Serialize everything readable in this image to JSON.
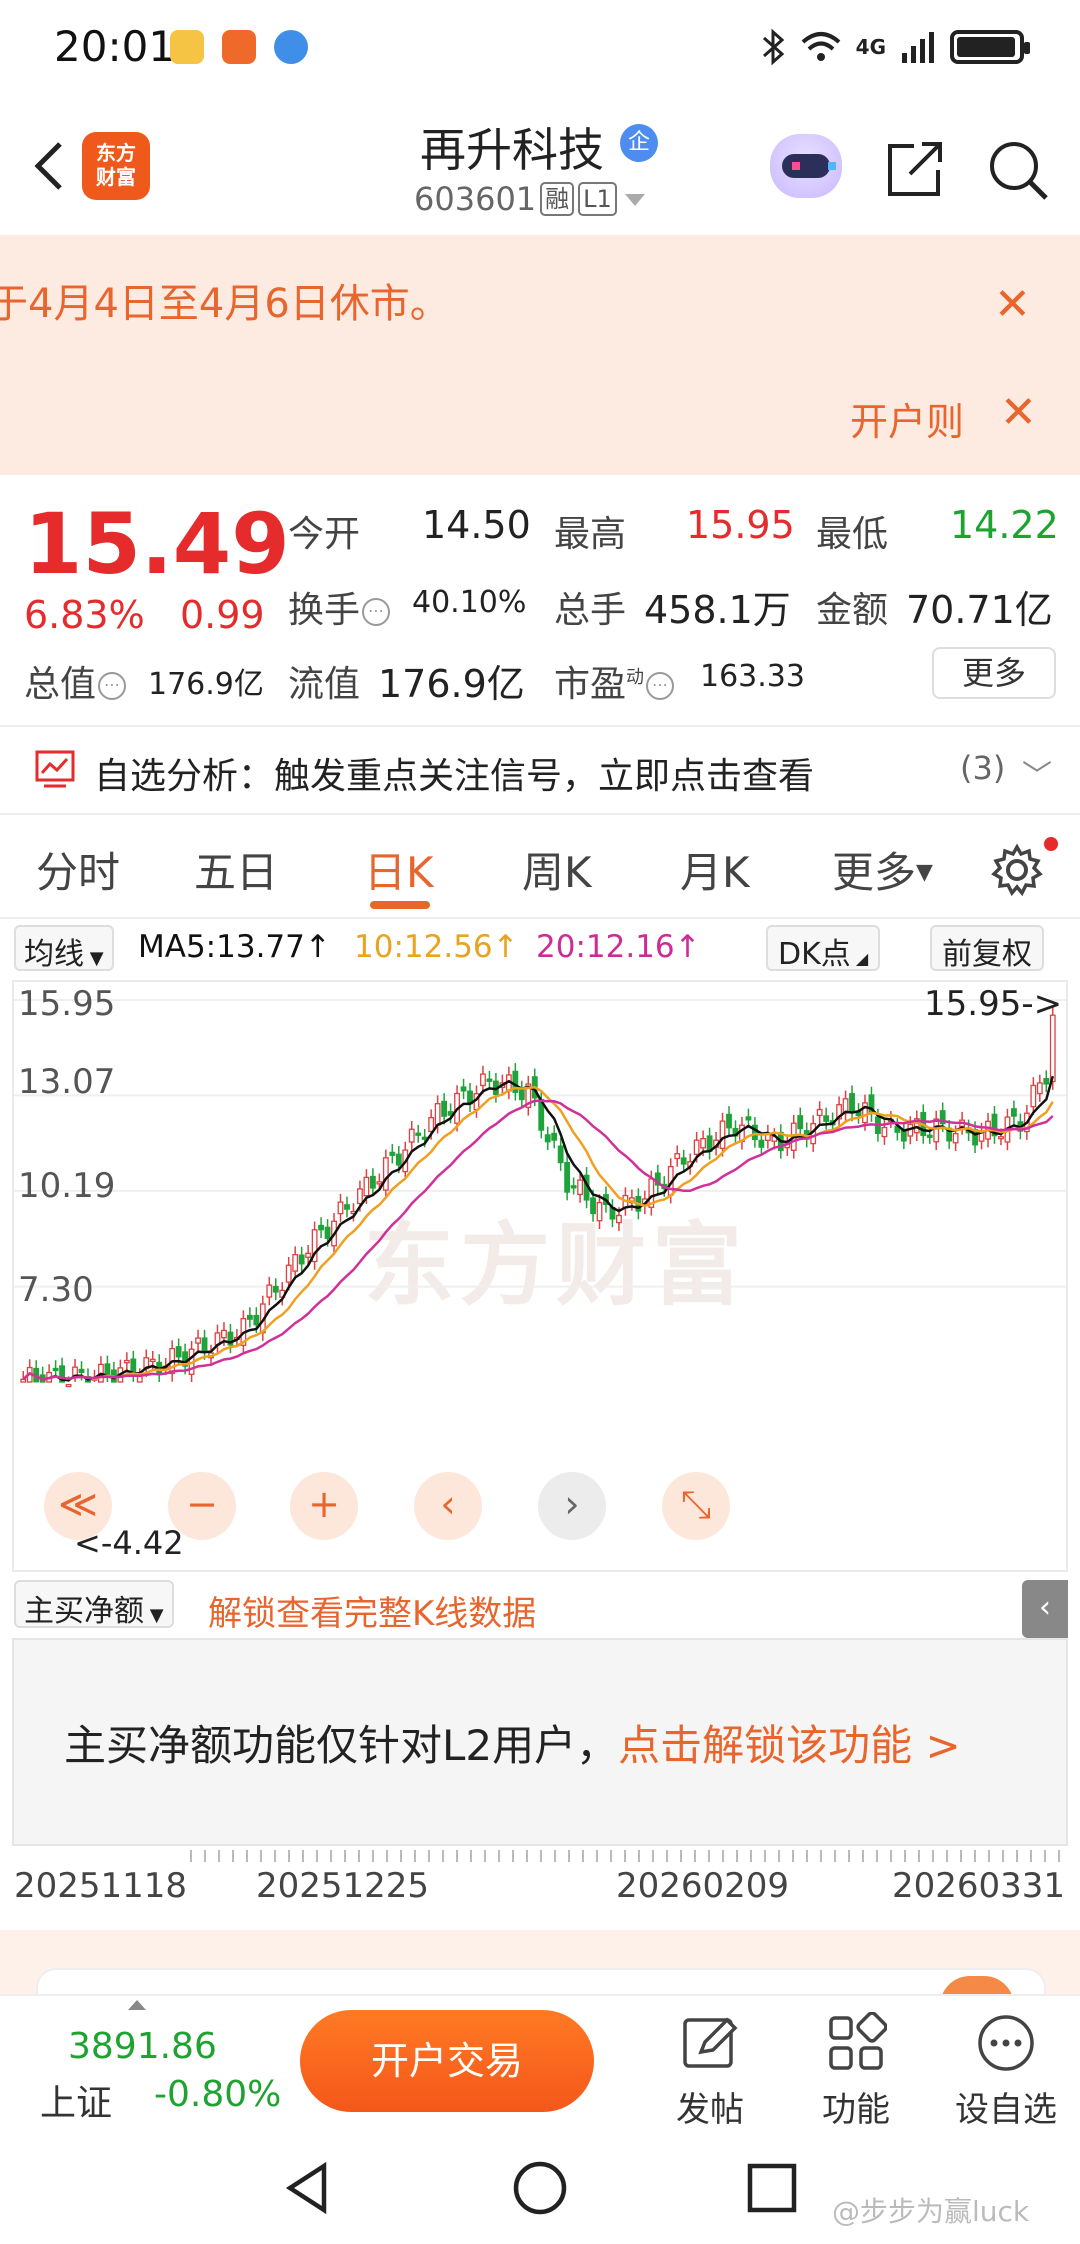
{
  "status_bar": {
    "time": "20:01",
    "network": "4G"
  },
  "header": {
    "brand": "东方\n财富",
    "stock_name": "再升科技",
    "badge": "企",
    "stock_code": "603601",
    "tags": [
      "融",
      "L1"
    ]
  },
  "notice": {
    "text": "于4月4日至4月6日休市。",
    "open_account": "开户则",
    "close": "✕"
  },
  "quote": {
    "price": "15.49",
    "change_pct": "6.83%",
    "change": "0.99",
    "open_label": "今开",
    "open": "14.50",
    "high_label": "最高",
    "high": "15.95",
    "low_label": "最低",
    "low": "14.22",
    "turnover_label": "换手",
    "turnover": "40.10%",
    "volume_label": "总手",
    "volume": "458.1万",
    "amount_label": "金额",
    "amount": "70.71亿",
    "mktcap_label": "总值",
    "mktcap": "176.9亿",
    "float_label": "流值",
    "float_cap": "176.9亿",
    "pe_label": "市盈",
    "pe_sup": "动",
    "pe": "163.33",
    "more": "更多"
  },
  "analysis": {
    "text": "自选分析：触发重点关注信号，立即点击查看",
    "count": "(3)"
  },
  "tabs": [
    "分时",
    "五日",
    "日K",
    "周K",
    "月K",
    "更多"
  ],
  "active_tab": "日K",
  "ma": {
    "selector": "均线",
    "ma5": "MA5:13.77↑",
    "ma10": "10:12.56↑",
    "ma20": "20:12.16↑",
    "dk": "DK点",
    "adjust": "前复权",
    "colors": {
      "ma5": "#111111",
      "ma10": "#f0a020",
      "ma20": "#d0309a",
      "up": "#e04040",
      "down": "#1fa33a"
    }
  },
  "chart": {
    "y_ticks": [
      "15.95",
      "13.07",
      "10.19",
      "7.30"
    ],
    "max_label": "15.95->",
    "min_label": "<-4.42",
    "watermark": "东方财富",
    "controls": [
      "≪",
      "−",
      "+",
      "‹",
      "›",
      "⤡"
    ]
  },
  "chart_data": {
    "type": "candlestick",
    "ylim": [
      4.42,
      15.95
    ],
    "x_labels": [
      "20251118",
      "20251225",
      "20260209",
      "20260331"
    ],
    "y_ticks": [
      15.95,
      13.07,
      10.19,
      7.3
    ],
    "series": [
      {
        "name": "MA5",
        "value": 13.77
      },
      {
        "name": "10",
        "value": 12.56
      },
      {
        "name": "20",
        "value": 12.16
      }
    ],
    "max": 15.95,
    "min": 4.42
  },
  "indicator": {
    "selector": "主买净额",
    "unlock": "解锁查看完整K线数据",
    "msg": "主买净额功能仅针对L2用户，",
    "link": "点击解锁该功能 >",
    "side_tab": "‹"
  },
  "dates": [
    "20251118",
    "20251225",
    "20260209",
    "20260331"
  ],
  "bottom": {
    "index_value": "3891.86",
    "index_name": "上证",
    "index_pct": "-0.80%",
    "trade": "开户交易",
    "items": [
      "发帖",
      "功能",
      "设自选"
    ]
  },
  "watermark_footer": "@步步为赢luck"
}
